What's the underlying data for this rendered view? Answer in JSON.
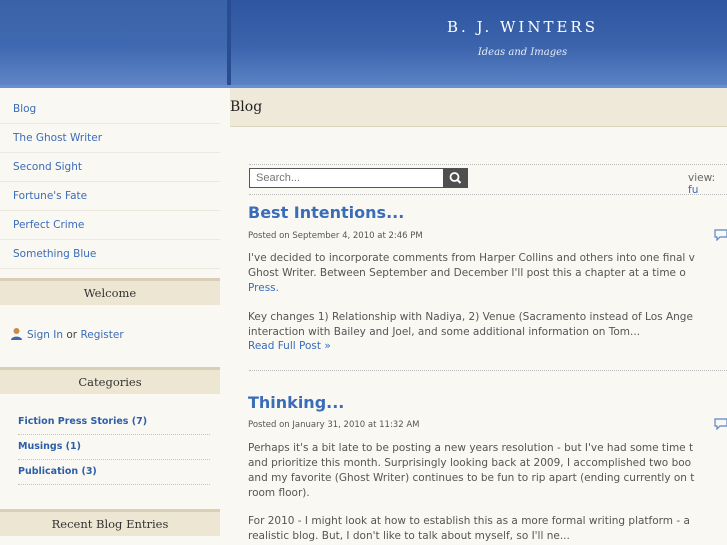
{
  "header": {
    "site_title": "B. J. WINTERS",
    "tagline": "Ideas and Images"
  },
  "sidebar": {
    "nav": [
      {
        "label": "Blog"
      },
      {
        "label": "The Ghost Writer"
      },
      {
        "label": "Second Sight"
      },
      {
        "label": "Fortune's Fate"
      },
      {
        "label": "Perfect Crime"
      },
      {
        "label": "Something Blue"
      }
    ],
    "welcome": {
      "heading": "Welcome",
      "sign_in": "Sign In",
      "or": "or",
      "register": "Register"
    },
    "categories": {
      "heading": "Categories",
      "items": [
        {
          "label": "Fiction Press Stories (7)"
        },
        {
          "label": "Musings (1)"
        },
        {
          "label": "Publication (3)"
        }
      ]
    },
    "recent": {
      "heading": "Recent Blog Entries"
    }
  },
  "main": {
    "title": "Blog",
    "search": {
      "placeholder": "Search..."
    },
    "view": {
      "label": "view:",
      "option": "fu"
    },
    "posts": [
      {
        "title": "Best Intentions...",
        "date": "Posted on September 4, 2010 at 2:46 PM",
        "p1_line1": "I've decided to incorporate comments from Harper Collins and others into one final v",
        "p1_line2": "Ghost Writer.   Between September and December I'll post this a chapter at a time o",
        "p1_line3_link": "Press.",
        "p2_line1": "Key changes 1) Relationship with Nadiya, 2) Venue (Sacramento instead of Los Ange",
        "p2_line2": "interaction with Bailey and Joel, and some additional information on Tom...",
        "read_more": "Read Full Post »"
      },
      {
        "title": "Thinking...",
        "date": "Posted on January 31, 2010 at 11:32 AM",
        "p1_line1": "Perhaps it's a bit late to be posting a new years resolution - but I've had some time t",
        "p1_line2": "and prioritize this month.  Surprisingly looking back at 2009, I accomplished two boo",
        "p1_line3": "and my favorite (Ghost Writer) continues to be fun to rip apart (ending currently on t",
        "p1_line4": "room floor).",
        "p2_line1": "For 2010 - I might look at how to establish this as a more formal writing platform - a",
        "p2_line2": "realistic blog.  But, I don't like to talk about myself, so I'll ne..."
      }
    ]
  }
}
